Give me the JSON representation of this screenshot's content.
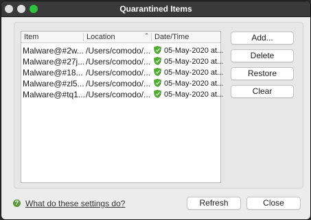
{
  "window": {
    "title": "Quarantined Items"
  },
  "table": {
    "headers": [
      "Item",
      "Location",
      "Date/Time"
    ],
    "rows": [
      {
        "item": "Malware@#2w...",
        "location": "/Users/comodo/...",
        "datetime": "05-May-2020 at..."
      },
      {
        "item": "Malware@#27j...",
        "location": "/Users/comodo/...",
        "datetime": "05-May-2020 at..."
      },
      {
        "item": "Malware@#18...",
        "location": "/Users/comodo/...",
        "datetime": "05-May-2020 at..."
      },
      {
        "item": "Malware@#zl5...",
        "location": "/Users/comodo/...",
        "datetime": "05-May-2020 at..."
      },
      {
        "item": "Malware@#tq1...",
        "location": "/Users/comodo/...",
        "datetime": "05-May-2020 at..."
      }
    ]
  },
  "actions": {
    "add": "Add...",
    "delete": "Delete",
    "restore": "Restore",
    "clear": "Clear"
  },
  "footer": {
    "help_link": "What do these settings do?",
    "refresh": "Refresh",
    "close": "Close"
  },
  "icons": {
    "close": "close-icon",
    "minimize": "minimize-icon",
    "maximize": "maximize-icon",
    "row": "shield-icon",
    "help": "help-icon"
  },
  "colors": {
    "titlebar": "#3a3a3a",
    "maximize": "#2ec23d",
    "shield": "#4caf2a",
    "help": "#5a9a3a"
  }
}
